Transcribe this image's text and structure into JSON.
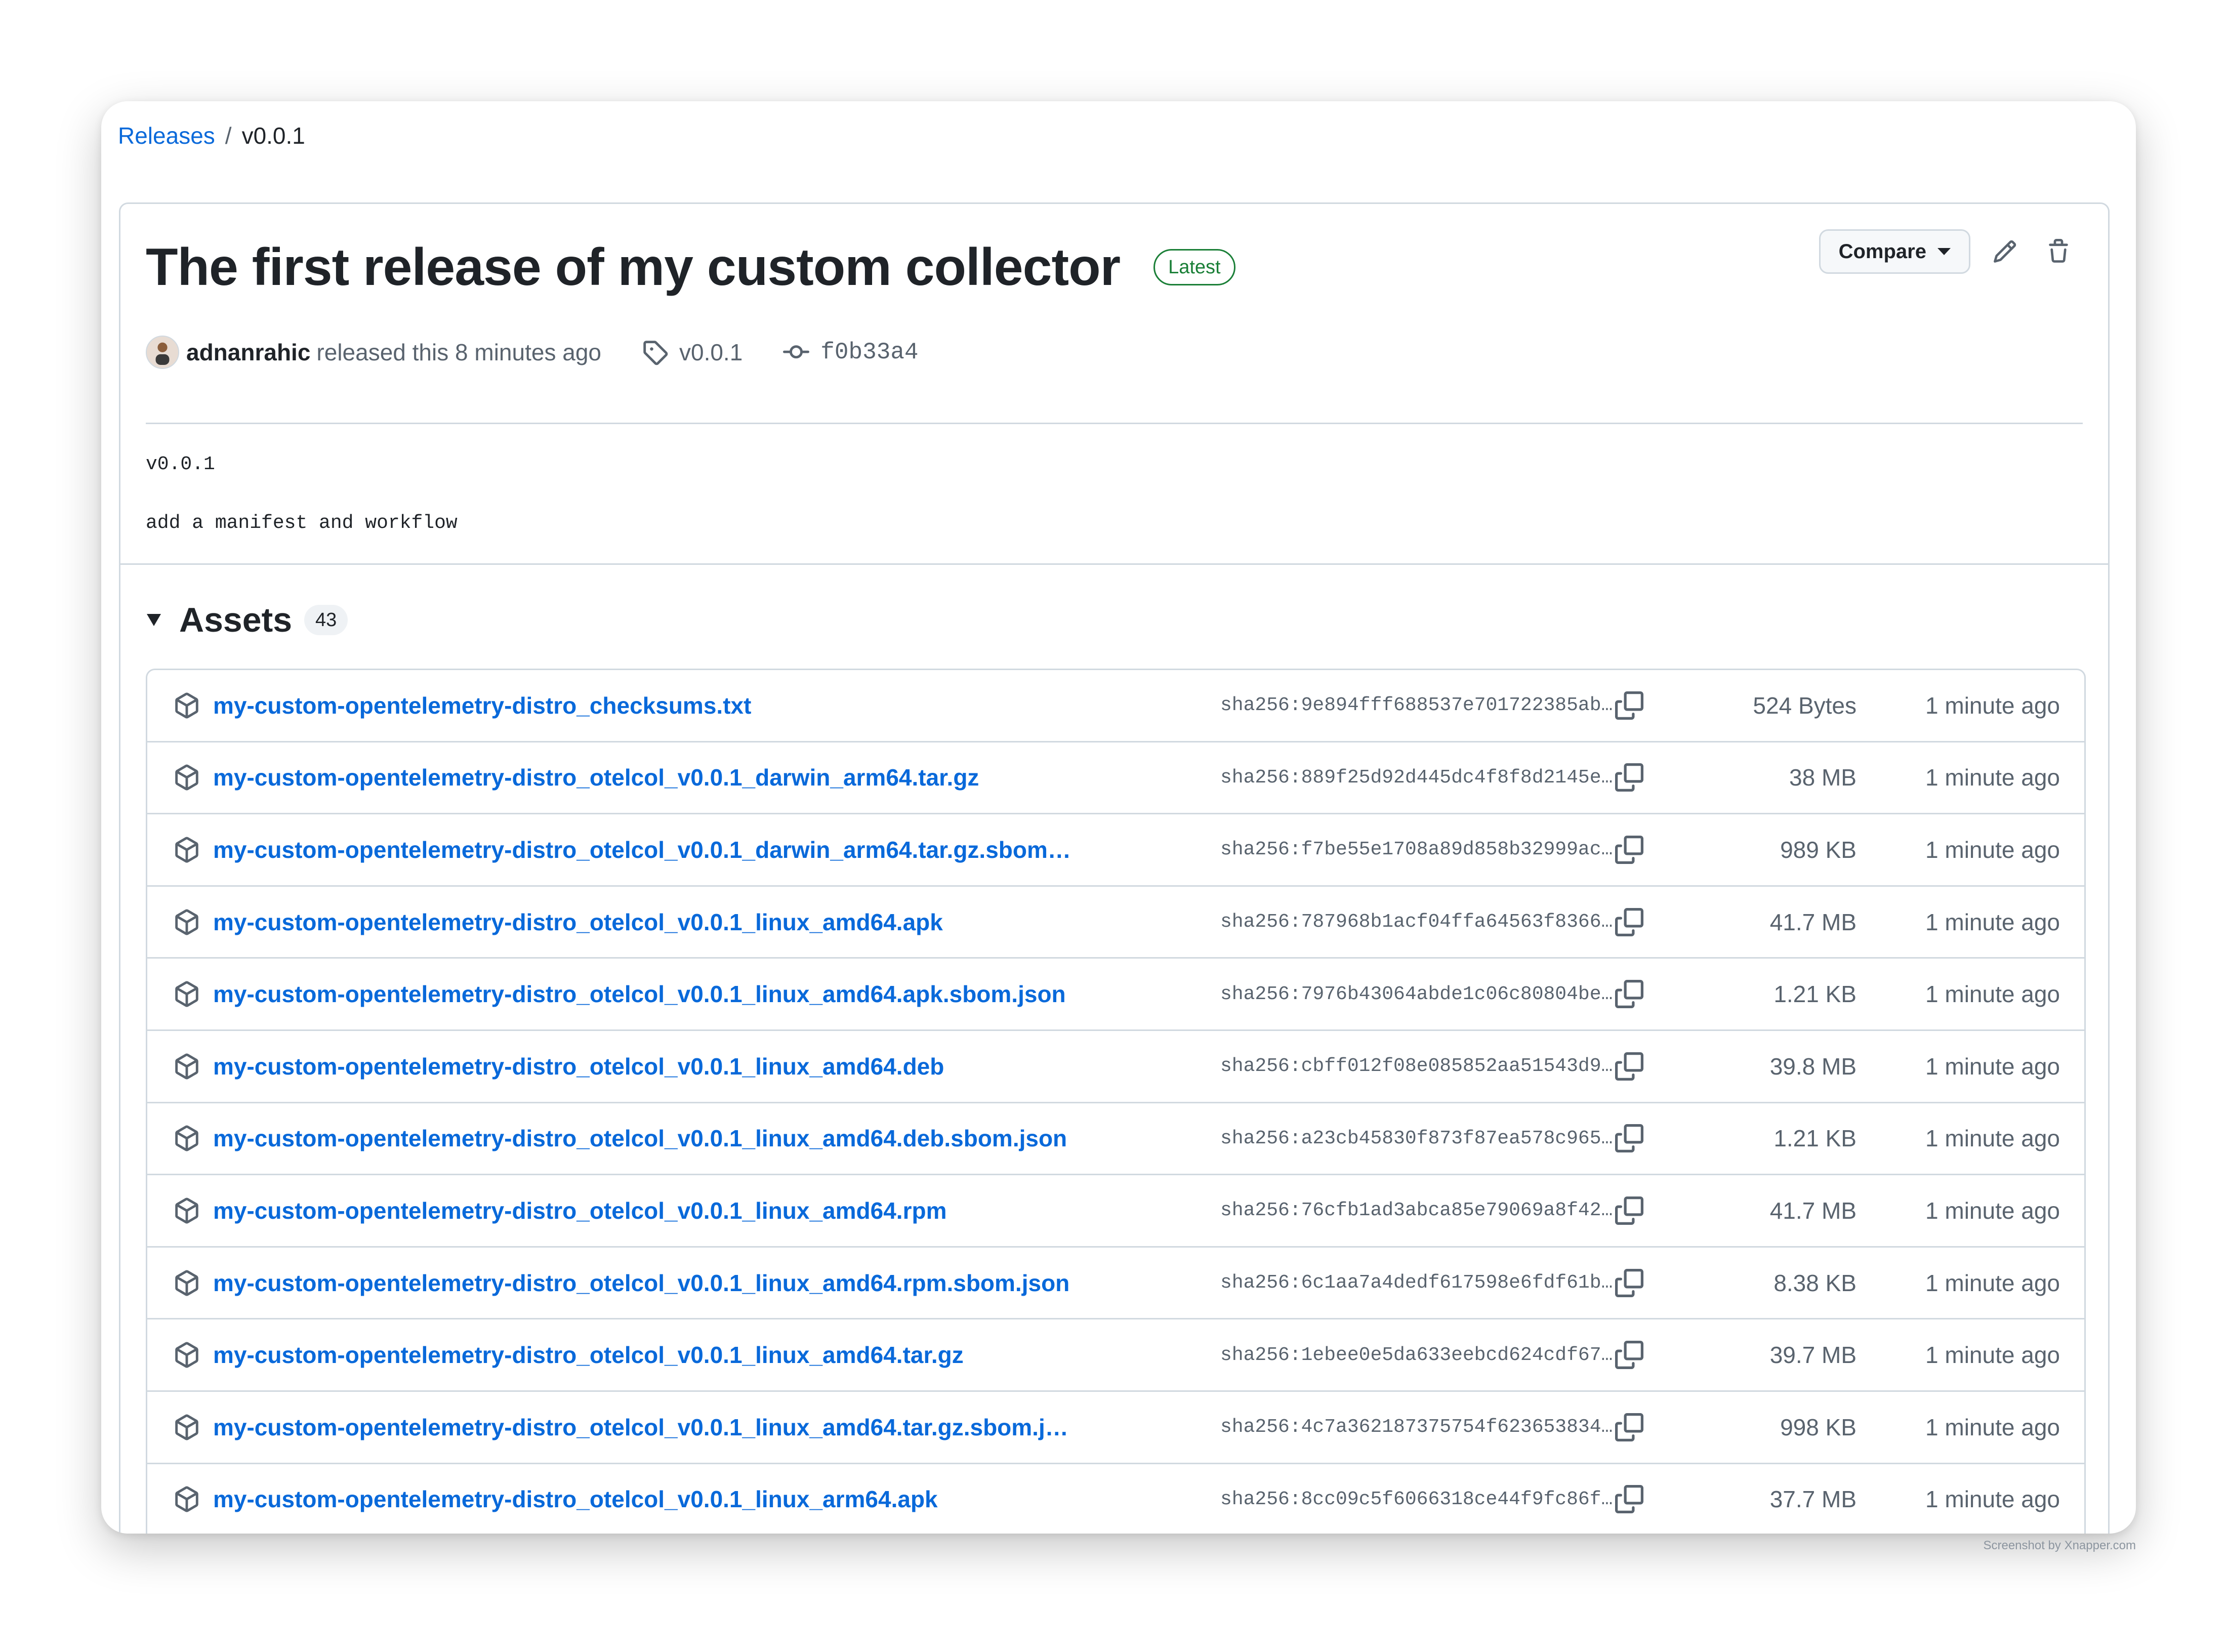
{
  "breadcrumb": {
    "link": "Releases",
    "separator": "/",
    "current": "v0.0.1"
  },
  "release": {
    "title": "The first release of my custom collector",
    "badge": "Latest",
    "compare_label": "Compare",
    "author": "adnanrahic",
    "released_text": "released this 8 minutes ago",
    "tag": "v0.0.1",
    "commit": "f0b33a4",
    "notes": [
      "v0.0.1",
      "add a manifest and workflow"
    ]
  },
  "assets": {
    "title": "Assets",
    "count": "43",
    "items": [
      {
        "name": "my-custom-opentelemetry-distro_checksums.txt",
        "sha": "sha256:9e894fff688537e701722385ab…",
        "size": "524 Bytes",
        "time": "1 minute ago"
      },
      {
        "name": "my-custom-opentelemetry-distro_otelcol_v0.0.1_darwin_arm64.tar.gz",
        "sha": "sha256:889f25d92d445dc4f8f8d2145e…",
        "size": "38 MB",
        "time": "1 minute ago"
      },
      {
        "name": "my-custom-opentelemetry-distro_otelcol_v0.0.1_darwin_arm64.tar.gz.sbom…",
        "sha": "sha256:f7be55e1708a89d858b32999ac…",
        "size": "989 KB",
        "time": "1 minute ago"
      },
      {
        "name": "my-custom-opentelemetry-distro_otelcol_v0.0.1_linux_amd64.apk",
        "sha": "sha256:787968b1acf04ffa64563f8366…",
        "size": "41.7 MB",
        "time": "1 minute ago"
      },
      {
        "name": "my-custom-opentelemetry-distro_otelcol_v0.0.1_linux_amd64.apk.sbom.json",
        "sha": "sha256:7976b43064abde1c06c80804be…",
        "size": "1.21 KB",
        "time": "1 minute ago"
      },
      {
        "name": "my-custom-opentelemetry-distro_otelcol_v0.0.1_linux_amd64.deb",
        "sha": "sha256:cbff012f08e085852aa51543d9…",
        "size": "39.8 MB",
        "time": "1 minute ago"
      },
      {
        "name": "my-custom-opentelemetry-distro_otelcol_v0.0.1_linux_amd64.deb.sbom.json",
        "sha": "sha256:a23cb45830f873f87ea578c965…",
        "size": "1.21 KB",
        "time": "1 minute ago"
      },
      {
        "name": "my-custom-opentelemetry-distro_otelcol_v0.0.1_linux_amd64.rpm",
        "sha": "sha256:76cfb1ad3abca85e79069a8f42…",
        "size": "41.7 MB",
        "time": "1 minute ago"
      },
      {
        "name": "my-custom-opentelemetry-distro_otelcol_v0.0.1_linux_amd64.rpm.sbom.json",
        "sha": "sha256:6c1aa7a4dedf617598e6fdf61b…",
        "size": "8.38 KB",
        "time": "1 minute ago"
      },
      {
        "name": "my-custom-opentelemetry-distro_otelcol_v0.0.1_linux_amd64.tar.gz",
        "sha": "sha256:1ebee0e5da633eebcd624cdf67…",
        "size": "39.7 MB",
        "time": "1 minute ago"
      },
      {
        "name": "my-custom-opentelemetry-distro_otelcol_v0.0.1_linux_amd64.tar.gz.sbom.j…",
        "sha": "sha256:4c7a362187375754f623653834…",
        "size": "998 KB",
        "time": "1 minute ago"
      },
      {
        "name": "my-custom-opentelemetry-distro_otelcol_v0.0.1_linux_arm64.apk",
        "sha": "sha256:8cc09c5f6066318ce44f9fc86f…",
        "size": "37.7 MB",
        "time": "1 minute ago"
      }
    ]
  },
  "icons": {
    "edit": "pencil-icon",
    "delete": "trash-icon",
    "tag": "tag-icon",
    "commit": "git-commit-icon",
    "asset": "package-icon",
    "copy": "copy-icon"
  },
  "colors": {
    "link": "#0969da",
    "latest_badge": "#1a7f37",
    "muted_text": "#59636e",
    "border": "#d1d9e0"
  },
  "watermark": "Screenshot by Xnapper.com"
}
